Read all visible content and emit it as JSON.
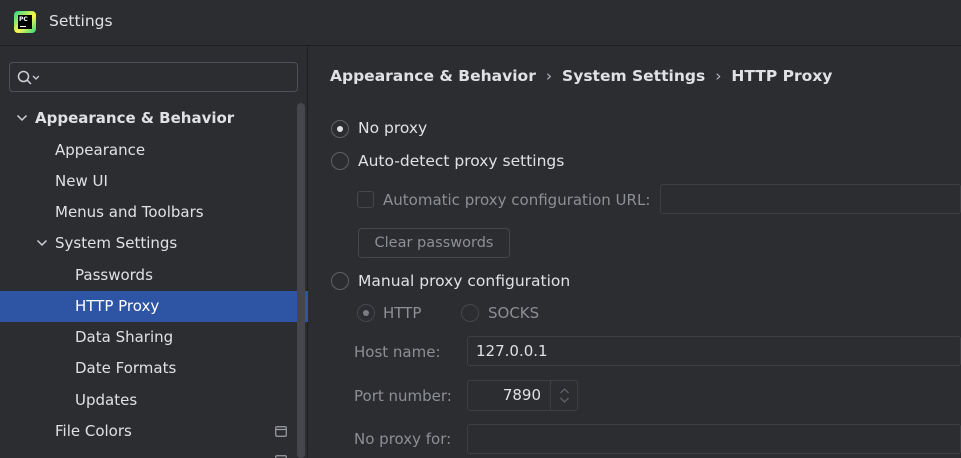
{
  "window": {
    "title": "Settings"
  },
  "search": {
    "placeholder": ""
  },
  "sidebar": {
    "items": [
      {
        "label": "Appearance & Behavior"
      },
      {
        "label": "Appearance"
      },
      {
        "label": "New UI"
      },
      {
        "label": "Menus and Toolbars"
      },
      {
        "label": "System Settings"
      },
      {
        "label": "Passwords"
      },
      {
        "label": "HTTP Proxy"
      },
      {
        "label": "Data Sharing"
      },
      {
        "label": "Date Formats"
      },
      {
        "label": "Updates"
      },
      {
        "label": "File Colors"
      }
    ]
  },
  "breadcrumb": {
    "items": [
      "Appearance & Behavior",
      "System Settings",
      "HTTP Proxy"
    ],
    "separator": "›"
  },
  "proxy": {
    "no_proxy_label": "No proxy",
    "auto_detect_label": "Auto-detect proxy settings",
    "auto_config_url_label": "Automatic proxy configuration URL:",
    "auto_config_url_value": "",
    "clear_passwords_label": "Clear passwords",
    "manual_label": "Manual proxy configuration",
    "http_label": "HTTP",
    "socks_label": "SOCKS",
    "host_label": "Host name:",
    "host_value": "127.0.0.1",
    "port_label": "Port number:",
    "port_value": "7890",
    "no_proxy_for_label": "No proxy for:",
    "no_proxy_for_value": ""
  },
  "colors": {
    "background": "#2b2d30",
    "selection": "#2e55a3",
    "text": "#dfe1e5",
    "disabled_text": "#8c8f94"
  }
}
